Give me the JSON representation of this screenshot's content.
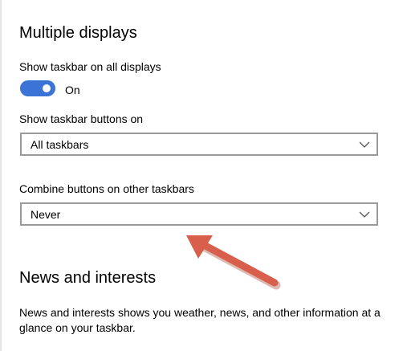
{
  "multiple_displays": {
    "title": "Multiple displays",
    "show_taskbar_all": {
      "label": "Show taskbar on all displays",
      "state_text": "On",
      "on": true
    },
    "show_buttons_on": {
      "label": "Show taskbar buttons on",
      "selected": "All taskbars"
    },
    "combine_buttons": {
      "label": "Combine buttons on other taskbars",
      "selected": "Never"
    }
  },
  "news": {
    "title": "News and interests",
    "description": "News and interests shows you weather, news, and other information at a glance on your taskbar."
  },
  "colors": {
    "toggle_on": "#3b73d6",
    "annotation_arrow": "#d75f4b"
  },
  "icons": {
    "dropdown": "chevron-down-icon"
  }
}
